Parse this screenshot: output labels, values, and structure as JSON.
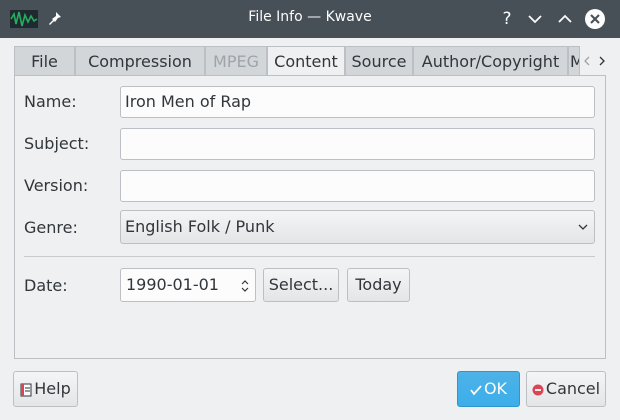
{
  "window": {
    "title": "File Info — Kwave",
    "help_glyph": "?",
    "icons": {
      "app": "kwave-waveform-icon",
      "pin": "pin-icon",
      "minimize": "chevron-down-icon",
      "maximize": "chevron-up-icon",
      "close": "close-icon"
    }
  },
  "tabs": [
    {
      "label": "File",
      "state": "normal"
    },
    {
      "label": "Compression",
      "state": "normal"
    },
    {
      "label": "MPEG",
      "state": "disabled"
    },
    {
      "label": "Content",
      "state": "active"
    },
    {
      "label": "Source",
      "state": "normal"
    },
    {
      "label": "Author/Copyright",
      "state": "normal"
    },
    {
      "label": "M",
      "state": "normal"
    }
  ],
  "form": {
    "name_label": "Name:",
    "name_value": "Iron Men of Rap",
    "subject_label": "Subject:",
    "subject_value": "",
    "version_label": "Version:",
    "version_value": "",
    "genre_label": "Genre:",
    "genre_value": "English Folk / Punk",
    "date_label": "Date:",
    "date_value": "1990-01-01",
    "select_label": "Select...",
    "today_label": "Today"
  },
  "buttons": {
    "help": "Help",
    "ok": "OK",
    "cancel": "Cancel"
  },
  "colors": {
    "titlebar": "#475057",
    "accent": "#3daee9",
    "cancel_icon": "#da4453"
  }
}
